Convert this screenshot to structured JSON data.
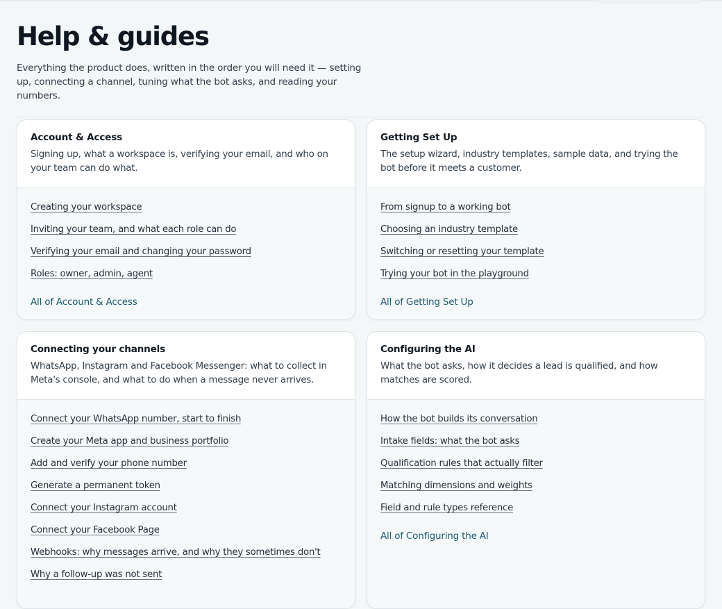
{
  "page": {
    "title": "Help & guides",
    "intro": "Everything the product does, written in the order you will need it — setting up, connecting a channel, tuning what the bot asks, and reading your numbers."
  },
  "cards": [
    {
      "title": "Account & Access",
      "description": "Signing up, what a workspace is, verifying your email, and who on your team can do what.",
      "links": [
        "Creating your workspace",
        "Inviting your team, and what each role can do",
        "Verifying your email and changing your password",
        "Roles: owner, admin, agent"
      ],
      "all_link": "All of Account & Access"
    },
    {
      "title": "Getting Set Up",
      "description": "The setup wizard, industry templates, sample data, and trying the bot before it meets a customer.",
      "links": [
        "From signup to a working bot",
        "Choosing an industry template",
        "Switching or resetting your template",
        "Trying your bot in the playground"
      ],
      "all_link": "All of Getting Set Up"
    },
    {
      "title": "Connecting your channels",
      "description": "WhatsApp, Instagram and Facebook Messenger: what to collect in Meta's console, and what to do when a message never arrives.",
      "links": [
        "Connect your WhatsApp number, start to finish",
        "Create your Meta app and business portfolio",
        "Add and verify your phone number",
        "Generate a permanent token",
        "Connect your Instagram account",
        "Connect your Facebook Page",
        "Webhooks: why messages arrive, and why they sometimes don't",
        "Why a follow-up was not sent"
      ],
      "all_link": ""
    },
    {
      "title": "Configuring the AI",
      "description": "What the bot asks, how it decides a lead is qualified, and how matches are scored.",
      "links": [
        "How the bot builds its conversation",
        "Intake fields: what the bot asks",
        "Qualification rules that actually filter",
        "Matching dimensions and weights",
        "Field and rule types reference"
      ],
      "all_link": "All of Configuring the AI"
    }
  ]
}
